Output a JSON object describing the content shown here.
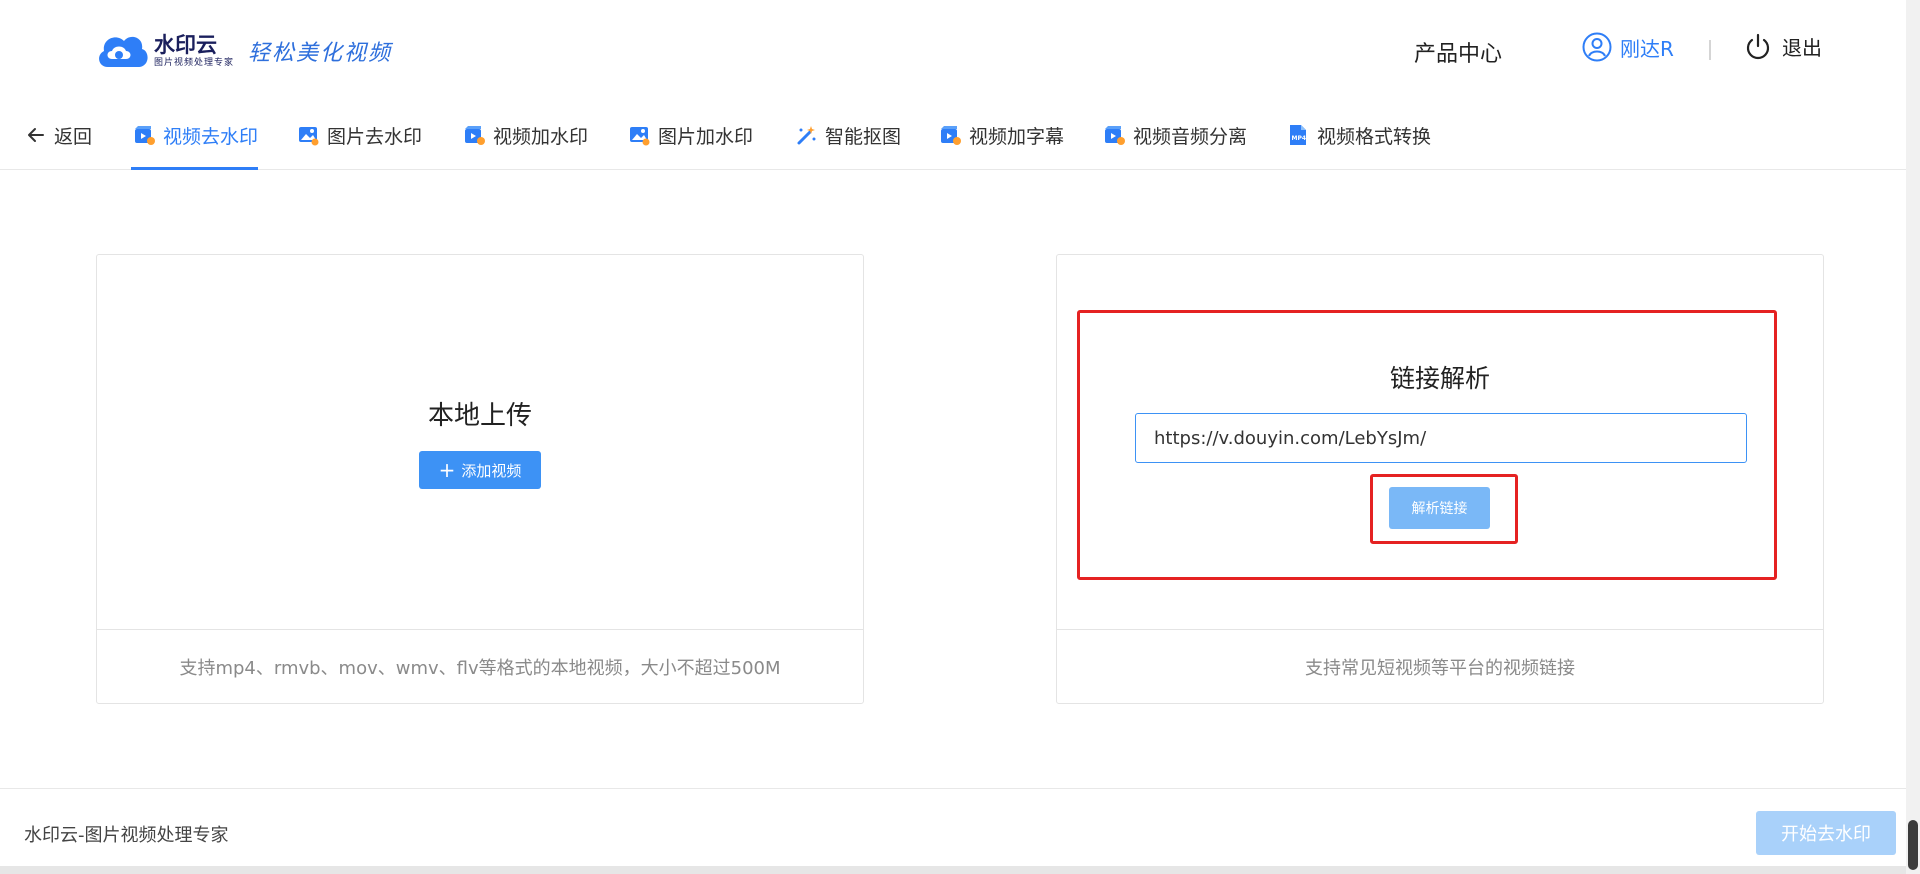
{
  "header": {
    "logo": {
      "name": "水印云",
      "subtitle": "图片视频处理专家",
      "slogan": "轻松美化视频"
    },
    "product_center": "产品中心",
    "user_name": "刚达R",
    "logout": "退出"
  },
  "nav": {
    "back": "返回",
    "tabs": [
      {
        "label": "视频去水印",
        "icon": "video-remove-icon",
        "active": true
      },
      {
        "label": "图片去水印",
        "icon": "image-remove-icon"
      },
      {
        "label": "视频加水印",
        "icon": "video-add-icon"
      },
      {
        "label": "图片加水印",
        "icon": "image-add-icon"
      },
      {
        "label": "智能抠图",
        "icon": "magic-wand-icon"
      },
      {
        "label": "视频加字幕",
        "icon": "video-subtitle-icon"
      },
      {
        "label": "视频音频分离",
        "icon": "audio-separate-icon"
      },
      {
        "label": "视频格式转换",
        "icon": "mp4-file-icon"
      }
    ]
  },
  "local_upload": {
    "title": "本地上传",
    "button": "添加视频",
    "footer": "支持mp4、rmvb、mov、wmv、flv等格式的本地视频，大小不超过500M"
  },
  "link_parse": {
    "title": "链接解析",
    "input_value": "https://v.douyin.com/LebYsJm/",
    "button": "解析链接",
    "footer": "支持常见短视频等平台的视频链接"
  },
  "bottom": {
    "brand_text": "水印云-图片视频处理专家",
    "start_button": "开始去水印"
  },
  "colors": {
    "accent": "#2e7ef7",
    "button": "#3d92f5",
    "highlight_border": "#e52222"
  }
}
